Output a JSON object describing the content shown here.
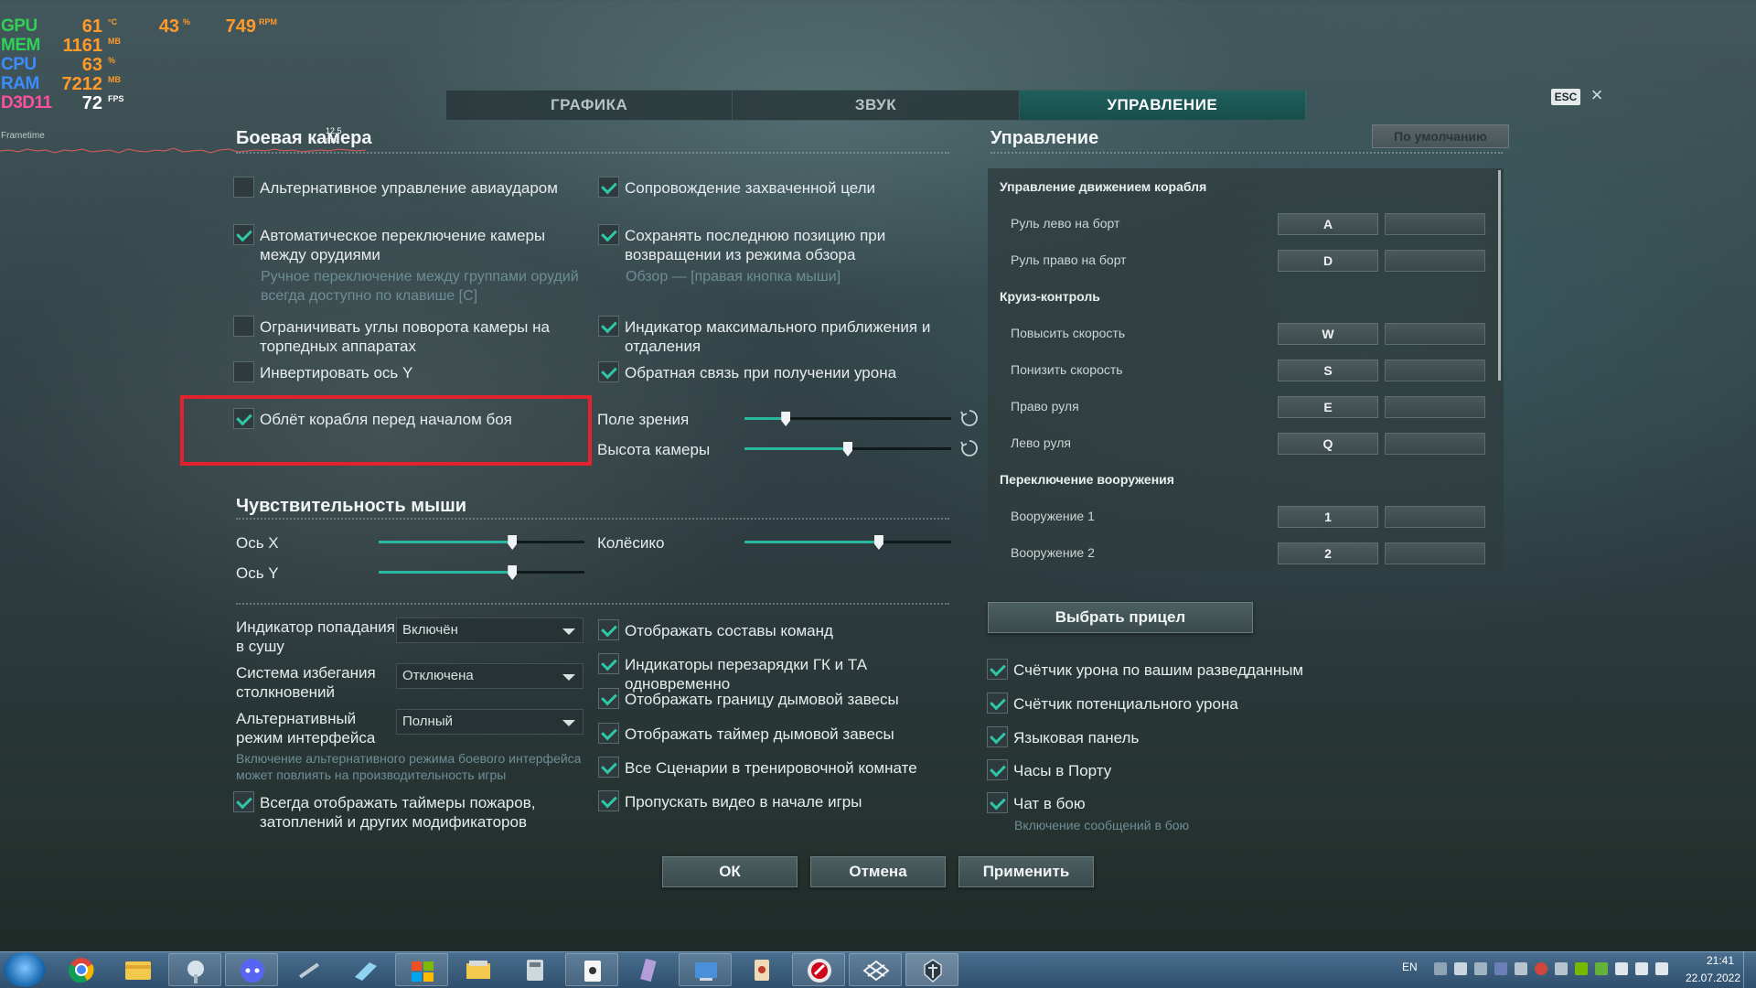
{
  "osd": {
    "gpu": {
      "label": "GPU",
      "temp": "61",
      "temp_unit": "°C",
      "load": "43",
      "load_unit": "%",
      "fan": "749",
      "fan_unit": "RPM"
    },
    "mem": {
      "label": "MEM",
      "value": "1161",
      "unit": "MB"
    },
    "cpu": {
      "label": "CPU",
      "value": "63",
      "unit": "%"
    },
    "ram": {
      "label": "RAM",
      "value": "7212",
      "unit": "MB"
    },
    "api": {
      "label": "D3D11",
      "value": "72",
      "unit": "FPS"
    },
    "frametime_label": "Frametime",
    "frametime_value": "12.5 ms"
  },
  "tabs": [
    "ГРАФИКА",
    "ЗВУК",
    "УПРАВЛЕНИЕ"
  ],
  "active_tab": "УПРАВЛЕНИЕ",
  "esc_label": "ESC",
  "close_glyph": "×",
  "combat_camera": {
    "title": "Боевая камера",
    "left": [
      {
        "label": "Альтернативное управление авиаударом",
        "checked": false
      },
      {
        "label": "Автоматическое переключение камеры между орудиями",
        "checked": true,
        "hint": "Ручное переключение между группами орудий всегда доступно по клавише [C]"
      },
      {
        "label": "Ограничивать углы поворота камеры на торпедных аппаратах",
        "checked": false
      },
      {
        "label": "Инвертировать ось Y",
        "checked": false
      },
      {
        "label": "Облёт корабля перед началом боя",
        "checked": true
      }
    ],
    "right": [
      {
        "label": "Сопровождение захваченной цели",
        "checked": true
      },
      {
        "label": "Сохранять последнюю позицию при возвращении из режима обзора",
        "checked": true,
        "hint": "Обзор — [правая кнопка мыши]"
      },
      {
        "label": "Индикатор максимального приближения и отдаления",
        "checked": true
      },
      {
        "label": "Обратная связь при получении урона",
        "checked": true
      }
    ],
    "sliders": [
      {
        "label": "Поле зрения",
        "value": 0.2
      },
      {
        "label": "Высота камеры",
        "value": 0.5
      }
    ]
  },
  "mouse": {
    "title": "Чувствительность мыши",
    "sliders": [
      {
        "label": "Ось X",
        "value": 0.65
      },
      {
        "label": "Ось Y",
        "value": 0.65
      },
      {
        "label": "Колёсико",
        "value": 0.65
      }
    ]
  },
  "misc": {
    "dropdowns": [
      {
        "label": "Индикатор попадания в сушу",
        "value": "Включён"
      },
      {
        "label": "Система избегания столкновений",
        "value": "Отключена"
      },
      {
        "label": "Альтернативный режим интерфейса",
        "value": "Полный"
      }
    ],
    "alt_ui_hint": "Включение альтернативного режима боевого интерфейса может повлиять на производительность игры",
    "timers": {
      "label": "Всегда отображать таймеры пожаров, затоплений и других модификаторов",
      "checked": true
    },
    "mid": [
      {
        "label": "Отображать составы команд",
        "checked": true
      },
      {
        "label": "Индикаторы перезарядки ГК и ТА одновременно",
        "checked": true
      },
      {
        "label": "Отображать границу дымовой завесы",
        "checked": true
      },
      {
        "label": "Отображать таймер дымовой завесы",
        "checked": true
      },
      {
        "label": "Все Сценарии в тренировочной комнате",
        "checked": true
      },
      {
        "label": "Пропускать видео в начале игры",
        "checked": true
      }
    ],
    "right": [
      {
        "label": "Счётчик урона по вашим разведданным",
        "checked": true
      },
      {
        "label": "Счётчик потенциального урона",
        "checked": true
      },
      {
        "label": "Языковая панель",
        "checked": true
      },
      {
        "label": "Часы в Порту",
        "checked": true
      },
      {
        "label": "Чат в бою",
        "checked": true
      }
    ],
    "chat_hint": "Включение сообщений в бою"
  },
  "controls": {
    "title": "Управление",
    "default_button": "По умолчанию",
    "groups": [
      {
        "name": "Управление движением корабля",
        "items": [
          {
            "label": "Руль лево на борт",
            "key": "A"
          },
          {
            "label": "Руль право на борт",
            "key": "D"
          }
        ]
      },
      {
        "name": "Круиз-контроль",
        "items": [
          {
            "label": "Повысить скорость",
            "key": "W"
          },
          {
            "label": "Понизить скорость",
            "key": "S"
          },
          {
            "label": "Право руля",
            "key": "E"
          },
          {
            "label": "Лево руля",
            "key": "Q"
          }
        ]
      },
      {
        "name": "Переключение вооружения",
        "items": [
          {
            "label": "Вооружение 1",
            "key": "1"
          },
          {
            "label": "Вооружение 2",
            "key": "2"
          }
        ]
      }
    ],
    "crosshair_button": "Выбрать прицел"
  },
  "footer": {
    "ok": "ОК",
    "cancel": "Отмена",
    "apply": "Применить"
  },
  "taskbar": {
    "lang": "EN",
    "time": "21:41",
    "date": "22.07.2022"
  }
}
